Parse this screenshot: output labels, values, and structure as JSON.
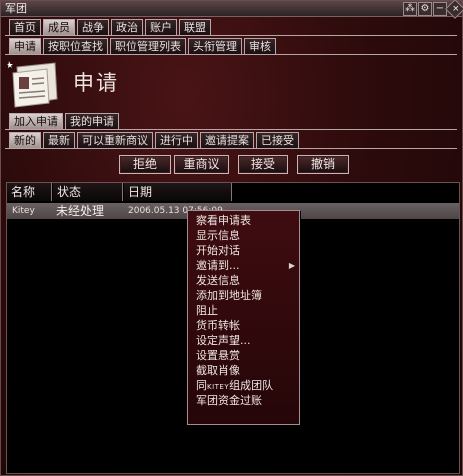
{
  "window": {
    "title": "军团"
  },
  "title_buttons": [
    {
      "name": "help",
      "glyph": "⁂"
    },
    {
      "name": "options",
      "glyph": "⚙"
    },
    {
      "name": "minimize",
      "glyph": "−"
    },
    {
      "name": "close",
      "glyph": "+"
    }
  ],
  "main_tabs": [
    "首页",
    "成员",
    "战争",
    "政治",
    "账户",
    "联盟"
  ],
  "sub_tabs": [
    "申请",
    "按职位查找",
    "职位管理列表",
    "头衔管理",
    "审核"
  ],
  "page": {
    "heading": "申请"
  },
  "apply_tabs": [
    "加入申请",
    "我的申请"
  ],
  "filter_tabs": [
    "新的",
    "最新",
    "可以重新商议",
    "进行中",
    "邀请提案",
    "已接受"
  ],
  "actions": {
    "reject": "拒绝",
    "renegotiate": "重商议",
    "accept": "接受",
    "revoke": "撤销"
  },
  "table": {
    "columns": [
      "名称",
      "状态",
      "日期"
    ],
    "rows": [
      {
        "name": "Kitey",
        "status": "未经处理",
        "date": "2006.05.13 07:56:09"
      }
    ]
  },
  "context_menu": {
    "items": [
      "察看申请表",
      "显示信息",
      "开始对话",
      "邀请到...",
      "发送信息",
      "添加到地址簿",
      "阻止",
      "货币转帐",
      "设定声望...",
      "设置悬赏",
      "截取肖像"
    ],
    "team_prefix": "同",
    "team_name": "KITEY",
    "team_suffix": "组成团队",
    "last": "军团资金过账"
  }
}
